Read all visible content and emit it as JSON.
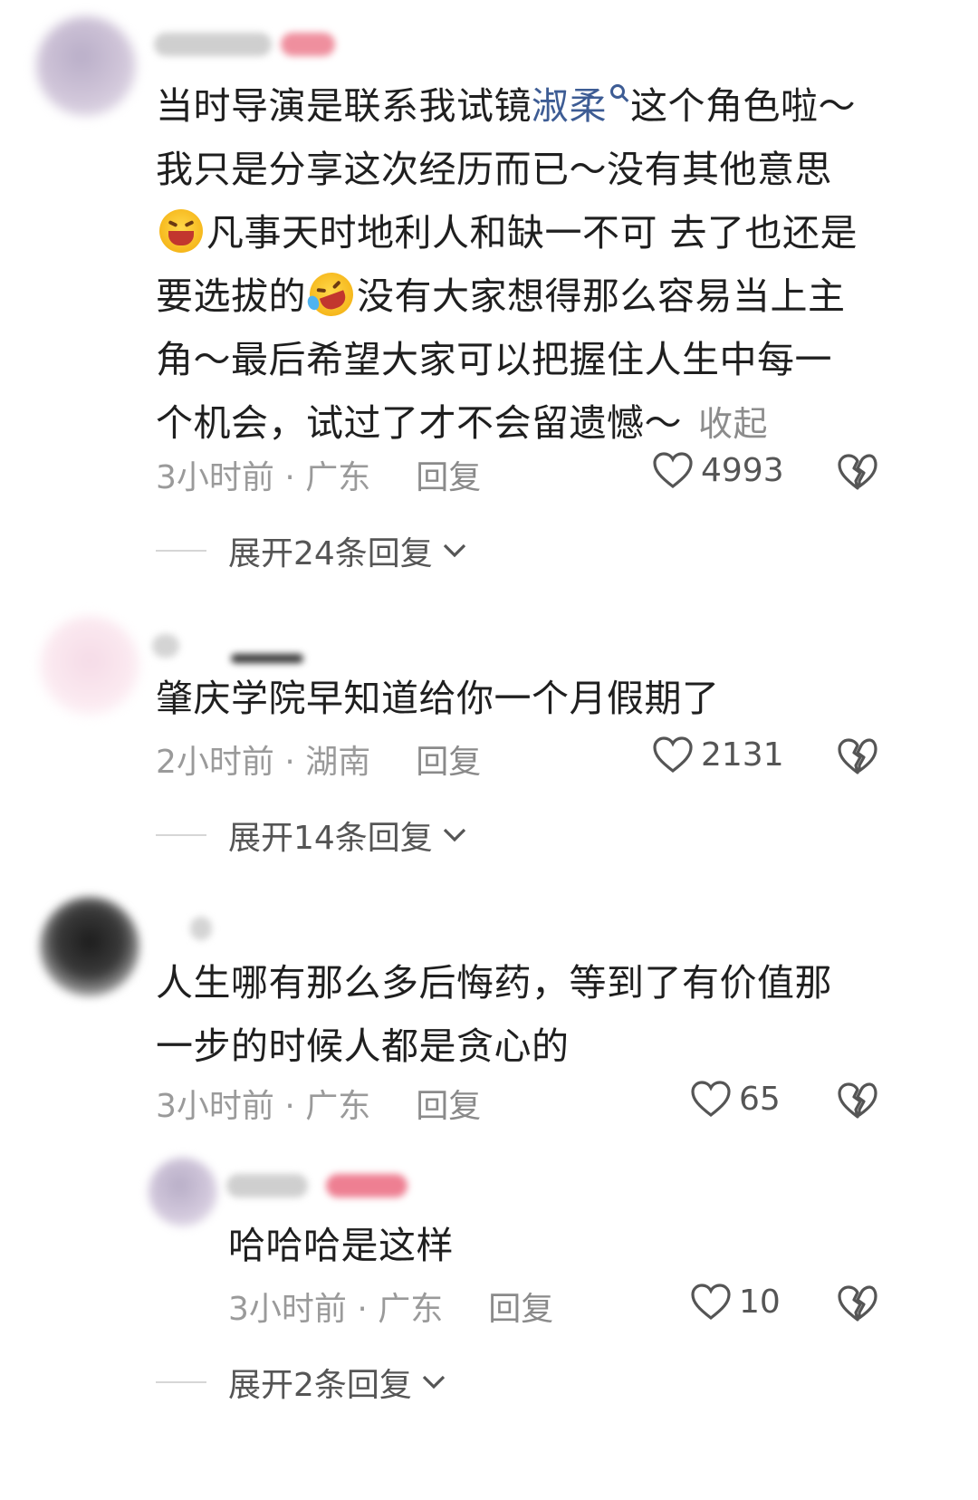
{
  "comments": [
    {
      "text_line1_before": "当时导演是联系我试镜",
      "link": "淑柔",
      "text_line1_after": "这个角色啦～",
      "text_line2": "我只是分享这次经历而已～没有其他意思",
      "text_line3": "凡事天时地利人和缺一不可 去了也还是",
      "text_line4_before": "要选拔的",
      "text_line4_after": "没有大家想得那么容易当上主",
      "text_line5": "角～最后希望大家可以把握住人生中每一",
      "text_line6": "个机会，试过了才不会留遗憾～",
      "collapse": "收起",
      "meta": "3小时前 · 广东",
      "reply": "回复",
      "likes": "4993",
      "expand": "展开24条回复"
    },
    {
      "text": "肇庆学院早知道给你一个月假期了",
      "meta": "2小时前 · 湖南",
      "reply": "回复",
      "likes": "2131",
      "expand": "展开14条回复"
    },
    {
      "text_line1": "人生哪有那么多后悔药，等到了有价值那",
      "text_line2": "一步的时候人都是贪心的",
      "meta": "3小时前 · 广东",
      "reply": "回复",
      "likes": "65"
    },
    {
      "text": "哈哈哈是这样",
      "meta": "3小时前 · 广东",
      "reply": "回复",
      "likes": "10",
      "expand": "展开2条回复"
    }
  ],
  "icons": {
    "like": "heart-outline-icon",
    "dislike": "broken-heart-icon",
    "expand": "chevron-down-icon",
    "emoji1": "laughing-emoji",
    "emoji2": "rolling-laughing-emoji"
  },
  "colors": {
    "link": "#3d5c94",
    "meta": "#9a9a9a",
    "text": "#1f1f1f"
  }
}
